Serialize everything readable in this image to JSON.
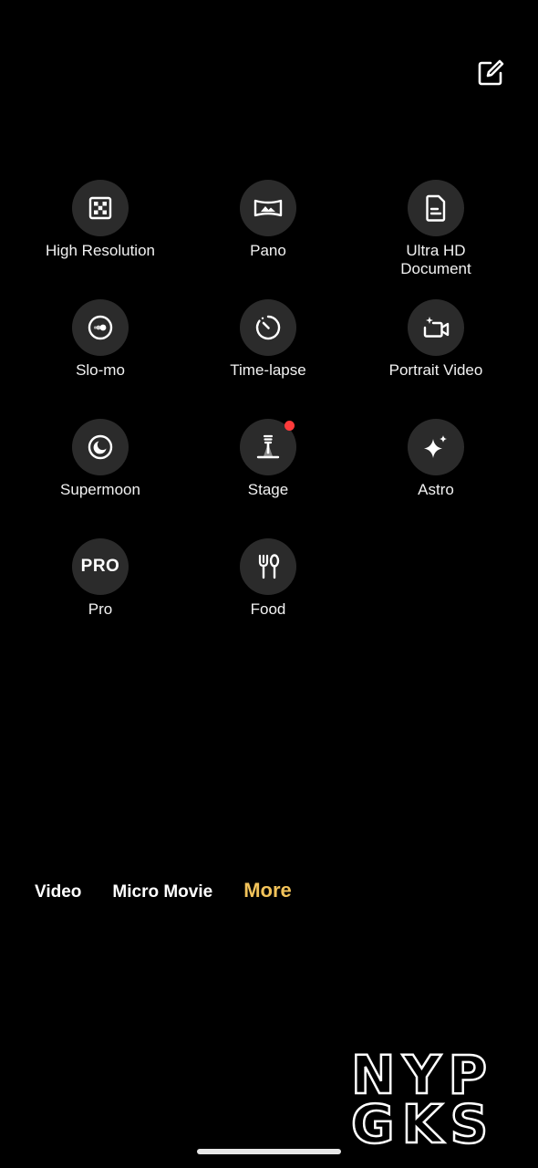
{
  "header": {
    "edit_icon": "edit-square-icon"
  },
  "modes": [
    {
      "label": "High Resolution",
      "icon": "high-resolution-icon"
    },
    {
      "label": "Pano",
      "icon": "panorama-icon"
    },
    {
      "label": "Ultra HD\nDocument",
      "icon": "document-icon"
    },
    {
      "label": "Slo-mo",
      "icon": "slow-motion-icon"
    },
    {
      "label": "Time-lapse",
      "icon": "timer-icon"
    },
    {
      "label": "Portrait Video",
      "icon": "portrait-video-icon"
    },
    {
      "label": "Supermoon",
      "icon": "moon-icon"
    },
    {
      "label": "Stage",
      "icon": "stage-spotlight-icon",
      "new_badge": true
    },
    {
      "label": "Astro",
      "icon": "sparkle-stars-icon"
    },
    {
      "label": "Pro",
      "icon_text": "PRO",
      "icon": "pro-icon"
    },
    {
      "label": "Food",
      "icon": "fork-spoon-icon"
    }
  ],
  "mode_bar": {
    "tabs": [
      "Video",
      "Micro Movie",
      "More"
    ],
    "active": "More",
    "active_color": "#f2c35a"
  },
  "watermark": {
    "text_line1": "NYP",
    "text_line2": "GKS"
  },
  "colors": {
    "background": "#000000",
    "icon_circle": "#2b2b2b",
    "badge": "#ff3b3b"
  }
}
